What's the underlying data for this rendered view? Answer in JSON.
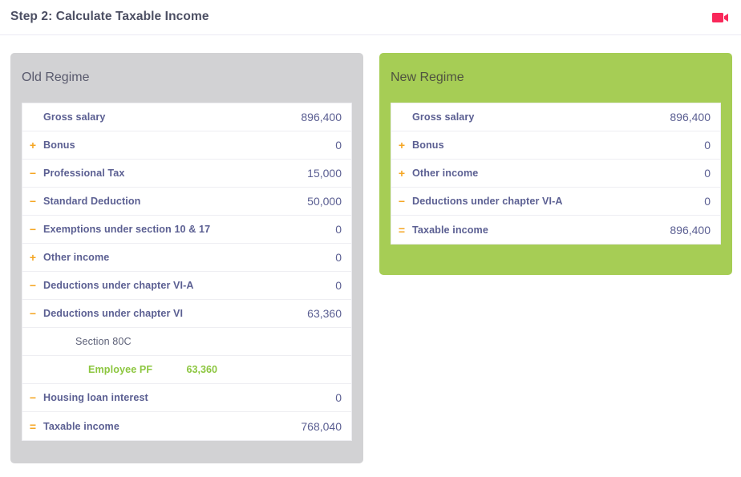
{
  "topbar": {
    "title": "Step 2: Calculate Taxable Income",
    "record_icon": "video-camera-icon",
    "record_color": "#f9285a"
  },
  "theme": {
    "old_card_bg": "#d2d2d4",
    "new_card_bg": "#a6cd55",
    "label_color": "#5b5f92",
    "sign_color": "#f5a623",
    "green_text": "#8cc63f"
  },
  "cards": [
    {
      "id": "old-regime",
      "title": "Old Regime",
      "rows": [
        {
          "sign": "",
          "label": "Gross salary",
          "value": "896,400"
        },
        {
          "sign": "+",
          "label": "Bonus",
          "value": "0"
        },
        {
          "sign": "−",
          "label": "Professional Tax",
          "value": "15,000"
        },
        {
          "sign": "−",
          "label": "Standard Deduction",
          "value": "50,000"
        },
        {
          "sign": "−",
          "label": "Exemptions under section 10 & 17",
          "value": "0"
        },
        {
          "sign": "+",
          "label": "Other income",
          "value": "0"
        },
        {
          "sign": "−",
          "label": "Deductions under chapter VI-A",
          "value": "0"
        },
        {
          "sign": "−",
          "label": "Deductions under chapter VI",
          "value": "63,360"
        },
        {
          "sign": "",
          "label": "Section 80C",
          "value": "",
          "type": "sub"
        },
        {
          "sign": "",
          "label": "Employee PF",
          "value": "63,360",
          "type": "sub-green"
        },
        {
          "sign": "−",
          "label": "Housing loan interest",
          "value": "0"
        },
        {
          "sign": "=",
          "label": "Taxable income",
          "value": "768,040"
        }
      ]
    },
    {
      "id": "new-regime",
      "title": "New Regime",
      "rows": [
        {
          "sign": "",
          "label": "Gross salary",
          "value": "896,400"
        },
        {
          "sign": "+",
          "label": "Bonus",
          "value": "0"
        },
        {
          "sign": "+",
          "label": "Other income",
          "value": "0"
        },
        {
          "sign": "−",
          "label": "Deductions under chapter VI-A",
          "value": "0"
        },
        {
          "sign": "=",
          "label": "Taxable income",
          "value": "896,400"
        }
      ]
    }
  ]
}
